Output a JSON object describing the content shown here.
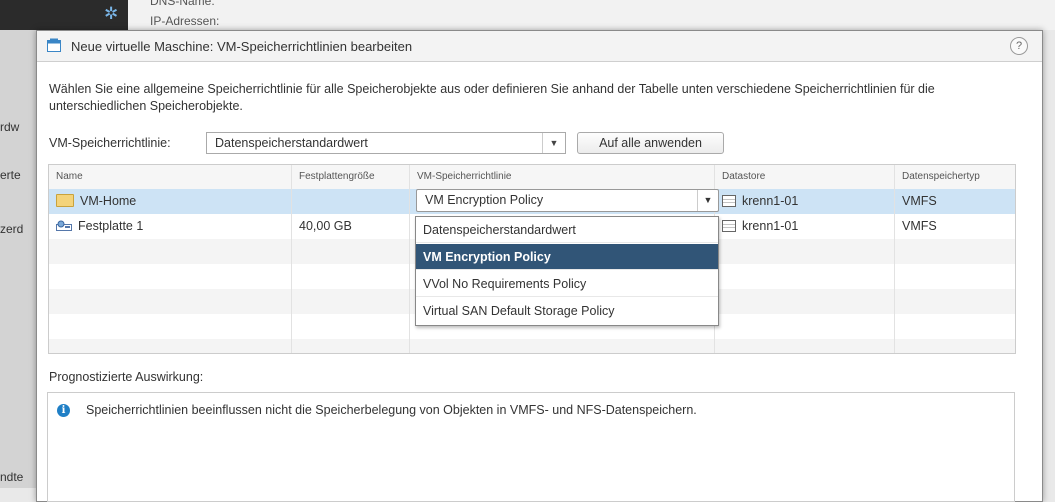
{
  "background": {
    "top_labels": [
      "DNS-Name:",
      "IP-Adressen:"
    ],
    "left_labels": [
      "rdw",
      "erte",
      "zerd",
      "ndte"
    ]
  },
  "dialog": {
    "title": "Neue virtuelle Maschine: VM-Speicherrichtlinien bearbeiten",
    "help": "?",
    "description": "Wählen Sie eine allgemeine Speicherrichtlinie für alle Speicherobjekte aus oder definieren Sie anhand der Tabelle unten verschiedene Speicherrichtlinien für die unterschiedlichen Speicherobjekte.",
    "policy_label": "VM-Speicherrichtlinie:",
    "policy_value": "Datenspeicherstandardwert",
    "apply_button": "Auf alle anwenden",
    "table": {
      "columns": [
        "Name",
        "Festplattengröße",
        "VM-Speicherrichtlinie",
        "Datastore",
        "Datenspeichertyp"
      ],
      "rows": [
        {
          "name": "VM-Home",
          "size": "",
          "policy": "VM Encryption Policy",
          "datastore": "krenn1-01",
          "type": "VMFS"
        },
        {
          "name": "Festplatte 1",
          "size": "40,00 GB",
          "policy": "",
          "datastore": "krenn1-01",
          "type": "VMFS"
        }
      ]
    },
    "dropdown_options": [
      "Datenspeicherstandardwert",
      "VM Encryption Policy",
      "VVol No Requirements Policy",
      "Virtual SAN Default Storage Policy"
    ],
    "dropdown_selected": "VM Encryption Policy",
    "impact_label": "Prognostizierte Auswirkung:",
    "impact_text": "Speicherrichtlinien beeinflussen nicht die Speicherbelegung von Objekten in VMFS- und NFS-Datenspeichern."
  }
}
